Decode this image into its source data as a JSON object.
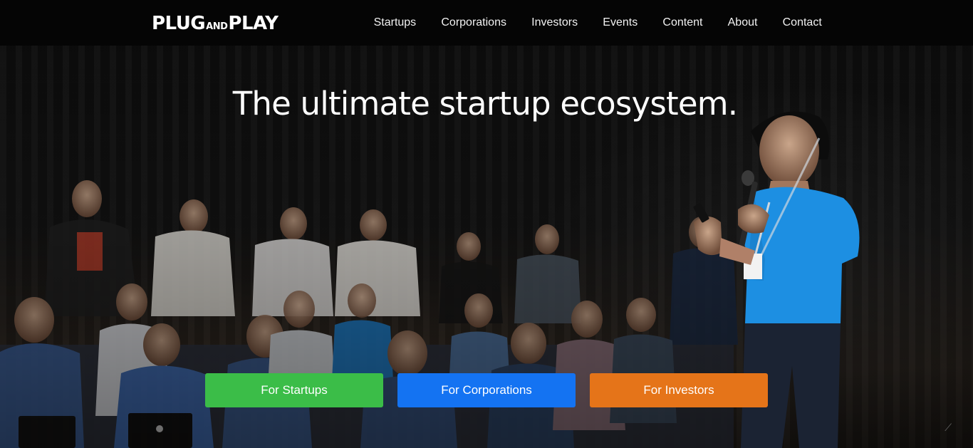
{
  "brand": {
    "logo_part1": "PLUG",
    "logo_part2": "AND",
    "logo_part3": "PLAY"
  },
  "nav": {
    "items": [
      {
        "label": "Startups"
      },
      {
        "label": "Corporations"
      },
      {
        "label": "Investors"
      },
      {
        "label": "Events"
      },
      {
        "label": "Content"
      },
      {
        "label": "About"
      },
      {
        "label": "Contact"
      }
    ]
  },
  "hero": {
    "headline": "The ultimate startup ecosystem.",
    "buttons": [
      {
        "label": "For Startups",
        "color": "#3bbd48"
      },
      {
        "label": "For Corporations",
        "color": "#1473f2"
      },
      {
        "label": "For Investors",
        "color": "#e57419"
      }
    ]
  },
  "colors": {
    "topbar": "#050505",
    "speaker_shirt": "#1a8fe0"
  },
  "icons": {
    "scroll_hint": "resize-grip-icon"
  }
}
